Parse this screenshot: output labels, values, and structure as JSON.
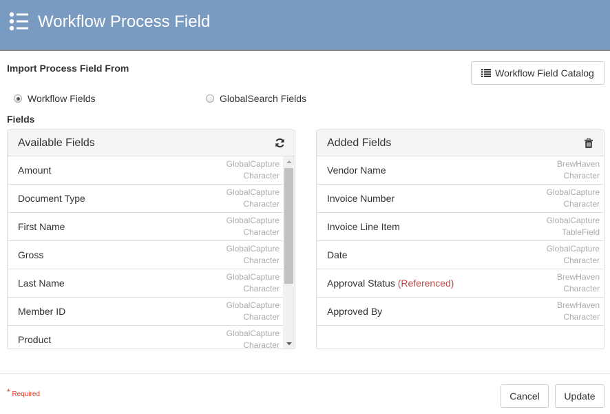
{
  "header": {
    "title": "Workflow Process Field",
    "icon": "list-bullets-icon"
  },
  "import": {
    "label": "Import Process Field From",
    "catalog_button": "Workflow Field Catalog",
    "catalog_icon": "list-icon",
    "options": [
      {
        "label": "Workflow Fields",
        "checked": true
      },
      {
        "label": "GlobalSearch Fields",
        "checked": false
      }
    ]
  },
  "fields_label": "Fields",
  "available": {
    "title": "Available Fields",
    "icon": "refresh-icon",
    "items": [
      {
        "name": "Amount",
        "source": "GlobalCapture",
        "type": "Character"
      },
      {
        "name": "Document Type",
        "source": "GlobalCapture",
        "type": "Character"
      },
      {
        "name": "First Name",
        "source": "GlobalCapture",
        "type": "Character"
      },
      {
        "name": "Gross",
        "source": "GlobalCapture",
        "type": "Character"
      },
      {
        "name": "Last Name",
        "source": "GlobalCapture",
        "type": "Character"
      },
      {
        "name": "Member ID",
        "source": "GlobalCapture",
        "type": "Character"
      },
      {
        "name": "Product",
        "source": "GlobalCapture",
        "type": "Character"
      }
    ]
  },
  "added": {
    "title": "Added Fields",
    "icon": "trash-icon",
    "items": [
      {
        "name": "Vendor Name",
        "note": "",
        "source": "BrewHaven",
        "type": "Character"
      },
      {
        "name": "Invoice Number",
        "note": "",
        "source": "GlobalCapture",
        "type": "Character"
      },
      {
        "name": "Invoice Line Item",
        "note": "",
        "source": "GlobalCapture",
        "type": "TableField"
      },
      {
        "name": "Date",
        "note": "",
        "source": "GlobalCapture",
        "type": "Character"
      },
      {
        "name": "Approval Status",
        "note": "(Referenced)",
        "source": "BrewHaven",
        "type": "Character"
      },
      {
        "name": "Approved By",
        "note": "",
        "source": "BrewHaven",
        "type": "Character"
      }
    ]
  },
  "footer": {
    "required_star": "*",
    "required_label": "Required",
    "cancel": "Cancel",
    "update": "Update"
  },
  "colors": {
    "header_bg": "#7a9bc1",
    "referenced": "#b94a48",
    "required": "#d9341d"
  }
}
